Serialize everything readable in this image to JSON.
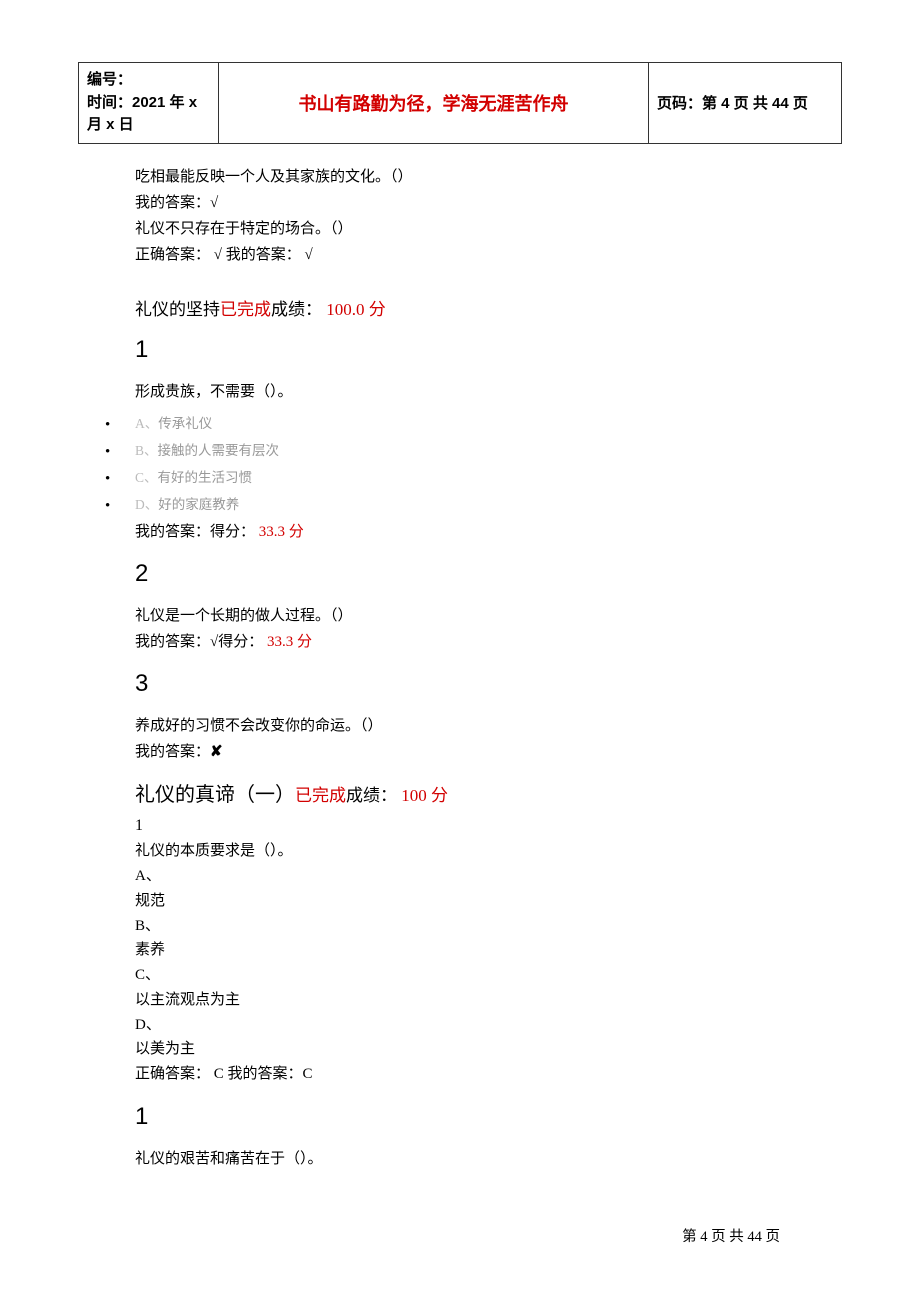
{
  "header": {
    "left_line1": "编号：",
    "left_line2": "时间：2021 年 x 月 x 日",
    "center": "书山有路勤为径，学海无涯苦作舟",
    "right": "页码：第 4 页  共 44 页"
  },
  "intro": {
    "l1": "吃相最能反映一个人及其家族的文化。（）",
    "l2_pre": "我的答案：",
    "l2_mark": "√",
    "l3": "礼仪不只存在于特定的场合。（）",
    "l4": "正确答案： √  我的答案： √"
  },
  "section1": {
    "title_black1": "礼仪的坚持",
    "title_red": "已完成",
    "title_black2": "成绩：",
    "title_score": " 100.0 分",
    "q1": {
      "num": "1",
      "text": "形成贵族，不需要（）。",
      "optA_letter": "A、",
      "optA_text": "传承礼仪",
      "optB_letter": "B、",
      "optB_text": "接触的人需要有层次",
      "optC_letter": "C、",
      "optC_text": "有好的生活习惯",
      "optD_letter": "D、",
      "optD_text": "好的家庭教养",
      "ans_pre": "我的答案：得分：",
      "ans_score": " 33.3 分"
    },
    "q2": {
      "num": "2",
      "text": "礼仪是一个长期的做人过程。（）",
      "ans_pre": "我的答案：",
      "ans_mark": "√",
      "ans_mid": "得分：",
      "ans_score": " 33.3 分"
    },
    "q3": {
      "num": "3",
      "text": "养成好的习惯不会改变你的命运。（）",
      "ans_pre": "我的答案：",
      "ans_mark": "✘"
    }
  },
  "section2": {
    "title_black1": "礼仪的真谛（一）",
    "title_red": "已完成",
    "title_black2": "成绩：",
    "title_score": " 100 分",
    "q1": {
      "num": "1",
      "text": "礼仪的本质要求是（）。",
      "a": "A、",
      "a_text": "规范",
      "b": "B、",
      "b_text": "素养",
      "c": "C、",
      "c_text": "以主流观点为主",
      "d": "D、",
      "d_text": "以美为主",
      "ans": "正确答案：  C  我的答案：C"
    },
    "q_extra": {
      "num": "1",
      "text": "礼仪的艰苦和痛苦在于（）。"
    }
  },
  "footer": "第  4  页  共  44  页"
}
